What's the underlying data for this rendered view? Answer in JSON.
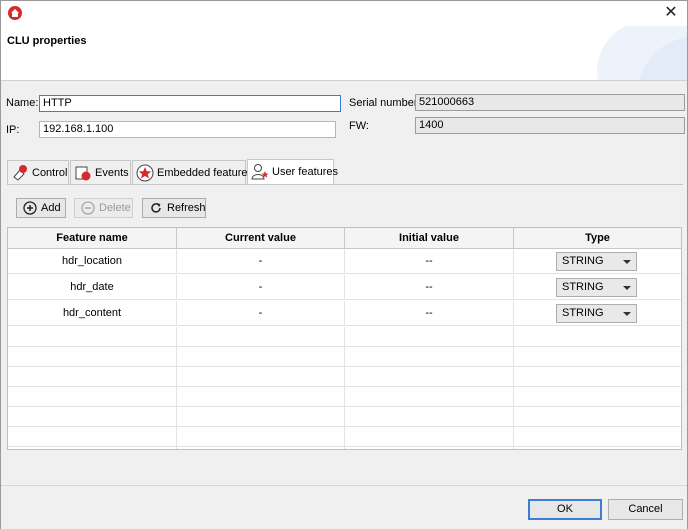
{
  "window": {
    "title": "CLU properties"
  },
  "form": {
    "name_label": "Name:",
    "name_value": "HTTP",
    "ip_label": "IP:",
    "ip_value": "192.168.1.100",
    "serial_label": "Serial number:",
    "serial_value": "521000663",
    "fw_label": "FW:",
    "fw_value": "1400"
  },
  "tabs": [
    {
      "label": "Control",
      "icon": "control-icon",
      "active": false
    },
    {
      "label": "Events",
      "icon": "events-icon",
      "active": false
    },
    {
      "label": "Embedded features",
      "icon": "star-icon",
      "active": false
    },
    {
      "label": "User features",
      "icon": "user-star-icon",
      "active": true
    }
  ],
  "toolbar": {
    "add_label": "Add",
    "delete_label": "Delete",
    "refresh_label": "Refresh"
  },
  "table": {
    "columns": [
      "Feature name",
      "Current value",
      "Initial value",
      "Type"
    ],
    "rows": [
      {
        "name": "hdr_location",
        "current": "-",
        "initial": "--",
        "type": "STRING"
      },
      {
        "name": "hdr_date",
        "current": "-",
        "initial": "--",
        "type": "STRING"
      },
      {
        "name": "hdr_content",
        "current": "-",
        "initial": "--",
        "type": "STRING"
      }
    ]
  },
  "footer": {
    "ok_label": "OK",
    "cancel_label": "Cancel"
  },
  "colors": {
    "accent": "#3a7fd5",
    "brand": "#d42b2b"
  }
}
